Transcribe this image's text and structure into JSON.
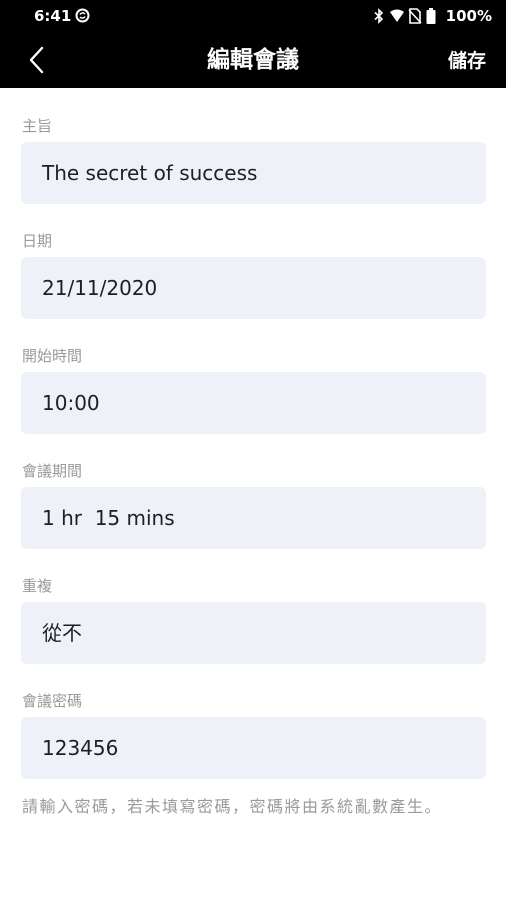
{
  "status_bar": {
    "time": "6:41",
    "battery": "100%"
  },
  "app_bar": {
    "title": "編輯會議",
    "save_label": "儲存"
  },
  "form": {
    "fields": [
      {
        "label": "主旨",
        "value": "The secret of success"
      },
      {
        "label": "日期",
        "value": "21/11/2020"
      },
      {
        "label": "開始時間",
        "value": "10:00"
      },
      {
        "label": "會議期間",
        "value": "1 hr  15 mins"
      },
      {
        "label": "重複",
        "value": "從不"
      },
      {
        "label": "會議密碼",
        "value": "123456"
      }
    ],
    "hint": "請輸入密碼，若未填寫密碼，密碼將由系統亂數產生。"
  },
  "colors": {
    "bar_background": "#000000",
    "field_background": "#eef1f8",
    "label_text": "#9a9a9a",
    "value_text": "#1f1f1f"
  },
  "icons": [
    "sync-icon",
    "bluetooth-icon",
    "wifi-icon",
    "no-sim-icon",
    "battery-icon",
    "back-arrow-icon"
  ]
}
